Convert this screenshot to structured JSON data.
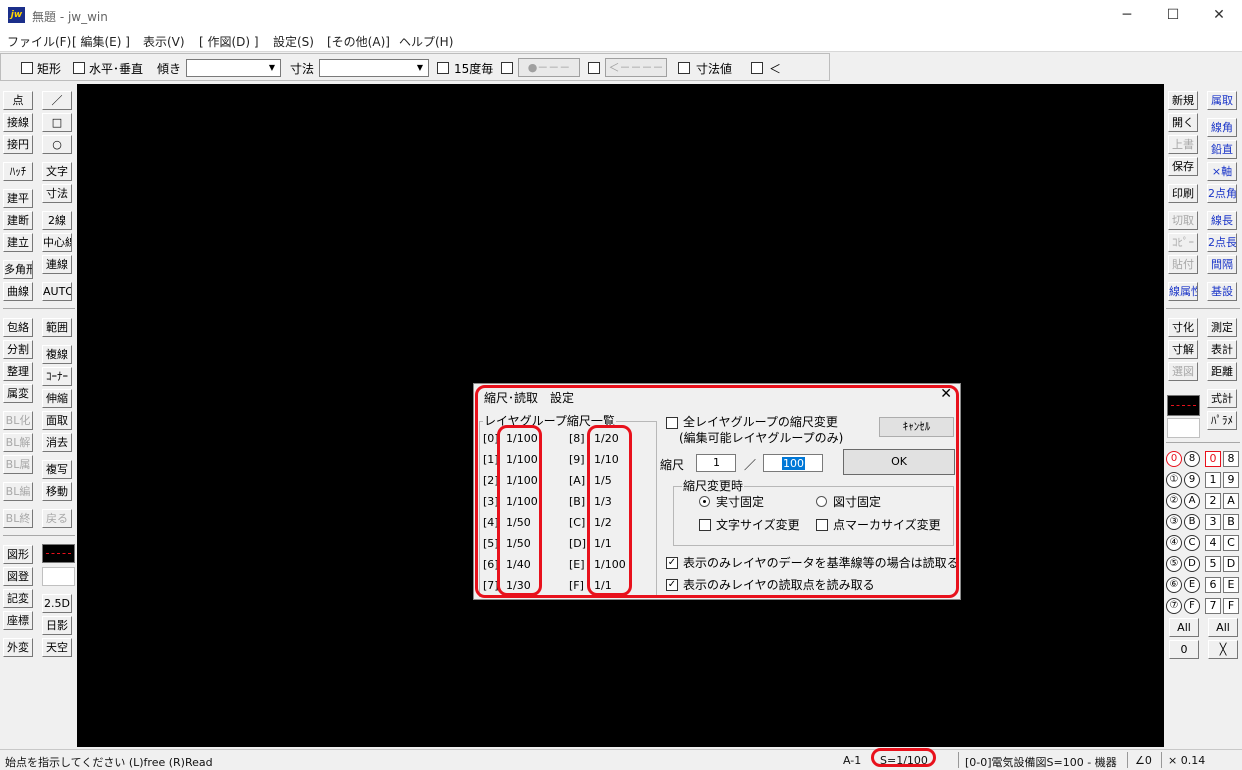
{
  "window": {
    "title": "無題 - jw_win",
    "app_icon": "jw",
    "minimize_icon": "─",
    "maximize_icon": "☐",
    "close_icon": "✕"
  },
  "menu": [
    "ファイル(F)",
    "[ 編集(E) ]",
    "表示(V)",
    "[ 作図(D) ]",
    "設定(S)",
    "[その他(A)]",
    "ヘルプ(H)"
  ],
  "toolbar": {
    "rect_label": "矩形",
    "hv_label": "水平･垂直",
    "tilt_label": "傾き",
    "dim_label": "寸法",
    "deg15_label": "15度毎",
    "btn1_label": "●－－－",
    "btn2_label": "＜－－－－",
    "dimval_label": "寸法値",
    "lt_label": "＜"
  },
  "left_col1": [
    "点",
    "接線",
    "接円",
    "ﾊｯﾁ",
    "建平",
    "建断",
    "建立",
    "多角形",
    "曲線",
    "包絡",
    "分割",
    "整理",
    "属変",
    "BL化",
    "BL解",
    "BL属",
    "BL編",
    "BL終",
    "図形",
    "図登",
    "記変",
    "座標",
    "外変"
  ],
  "left_col2": [
    "／",
    "□",
    "○",
    "文字",
    "寸法",
    "2線",
    "中心線",
    "連線",
    "AUTO",
    "範囲",
    "複線",
    "ｺｰﾅｰ",
    "伸縮",
    "面取",
    "消去",
    "複写",
    "移動",
    "戻る",
    "2.5D",
    "日影",
    "天空"
  ],
  "right_col1": [
    "新規",
    "開く",
    "上書",
    "保存",
    "印刷",
    "切取",
    "ｺﾋﾟｰ",
    "貼付",
    "線属性",
    "寸化",
    "寸解",
    "選図"
  ],
  "right_col2": [
    "属取",
    "線角",
    "鉛直",
    "×軸",
    "2点角",
    "線長",
    "2点長",
    "間隔",
    "基設",
    "測定",
    "表計",
    "距離",
    "式計",
    "ﾊﾟﾗﾒ"
  ],
  "layers": {
    "group_circles": [
      "0",
      "①",
      "②",
      "③",
      "④",
      "⑤",
      "⑥",
      "⑦"
    ],
    "group_letters": [
      "8",
      "9",
      "A",
      "B",
      "C",
      "D",
      "E",
      "F"
    ],
    "layer_nums": [
      "0",
      "1",
      "2",
      "3",
      "4",
      "5",
      "6",
      "7"
    ],
    "layer_letters": [
      "8",
      "9",
      "A",
      "B",
      "C",
      "D",
      "E",
      "F"
    ],
    "all_label": "All",
    "zero_label": "0",
    "x_label": "╳"
  },
  "dialog": {
    "title": "縮尺･読取　設定",
    "close": "✕",
    "list_title": "レイヤグループ縮尺一覧",
    "left_keys": [
      "[0]",
      "[1]",
      "[2]",
      "[3]",
      "[4]",
      "[5]",
      "[6]",
      "[7]"
    ],
    "left_vals": [
      "1/100",
      "1/100",
      "1/100",
      "1/100",
      "1/50",
      "1/50",
      "1/40",
      "1/30"
    ],
    "right_keys": [
      "[8]",
      "[9]",
      "[A]",
      "[B]",
      "[C]",
      "[D]",
      "[E]",
      "[F]"
    ],
    "right_vals": [
      "1/20",
      "1/10",
      "1/5",
      "1/3",
      "1/2",
      "1/1",
      "1/100",
      "1/1"
    ],
    "all_change_label": "全レイヤグループの縮尺変更",
    "all_change_sub": "(編集可能レイヤグループのみ)",
    "cancel": "ｷｬﾝｾﾙ",
    "scale_label": "縮尺",
    "scale_num": "1",
    "scale_slash": "／",
    "scale_den": "100",
    "ok": "OK",
    "change_group": "縮尺変更時",
    "radio_real": "実寸固定",
    "radio_fig": "図寸固定",
    "chk_text": "文字サイズ変更",
    "chk_point": "点マーカサイズ変更",
    "chk_ref": "表示のみレイヤのデータを基準線等の場合は読取る",
    "chk_read": "表示のみレイヤの読取点を読み取る"
  },
  "status": {
    "message": "始点を指示してください (L)free (R)Read",
    "paper": "A-1",
    "scale": "S=1/100",
    "layer": "[0-0]電気設備図S=100 - 機器",
    "angle": "∠0",
    "mult": "× 0.14"
  },
  "colors": {
    "highlight": "#e8111c",
    "canvas": "#000000",
    "icon_bg": "#1b2f8a",
    "link_blue": "#1a35c8"
  }
}
